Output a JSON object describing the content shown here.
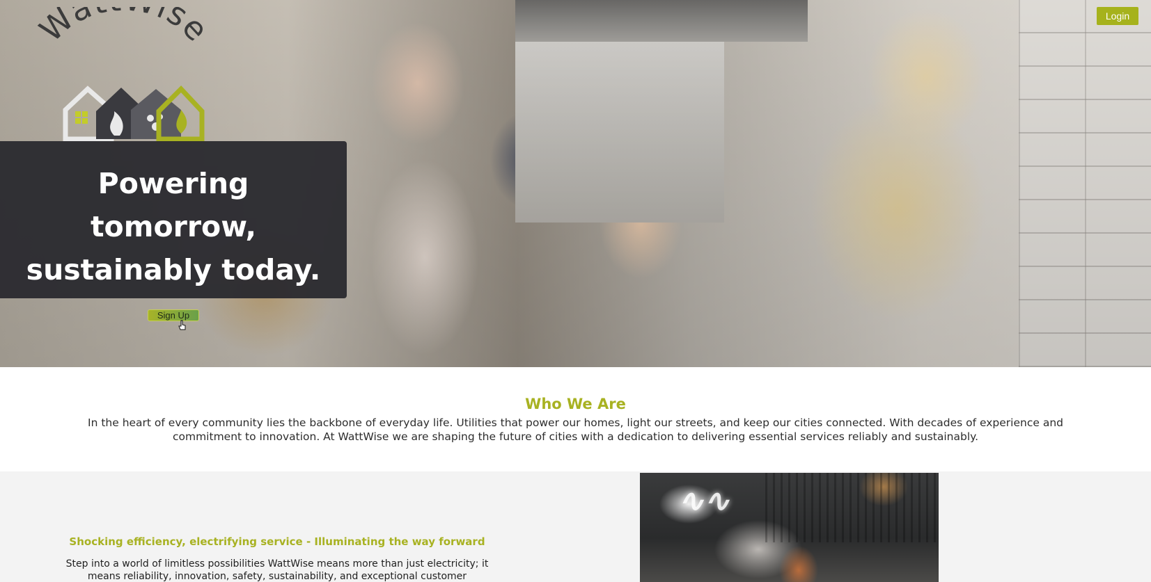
{
  "brand": {
    "name": "WattWise",
    "accent": "#a8b222"
  },
  "header": {
    "login_label": "Login"
  },
  "hero": {
    "title_line1": "Powering tomorrow,",
    "title_line2": "sustainably today.",
    "signup_label": "Sign Up"
  },
  "who": {
    "title": "Who We Are",
    "text": "In the heart of every community lies the backbone of everyday life. Utilities that power our homes, light our streets, and keep our cities connected. With decades of experience and commitment to innovation. At WattWise we are shaping the future of cities with a dedication to delivering essential services reliably and sustainably."
  },
  "features": {
    "title": "Shocking efficiency, electrifying service - Illuminating the way forward",
    "text": "Step into a world of limitless possibilities WattWise means more than just electricity; it means reliability, innovation, safety, sustainability, and exceptional customer"
  }
}
